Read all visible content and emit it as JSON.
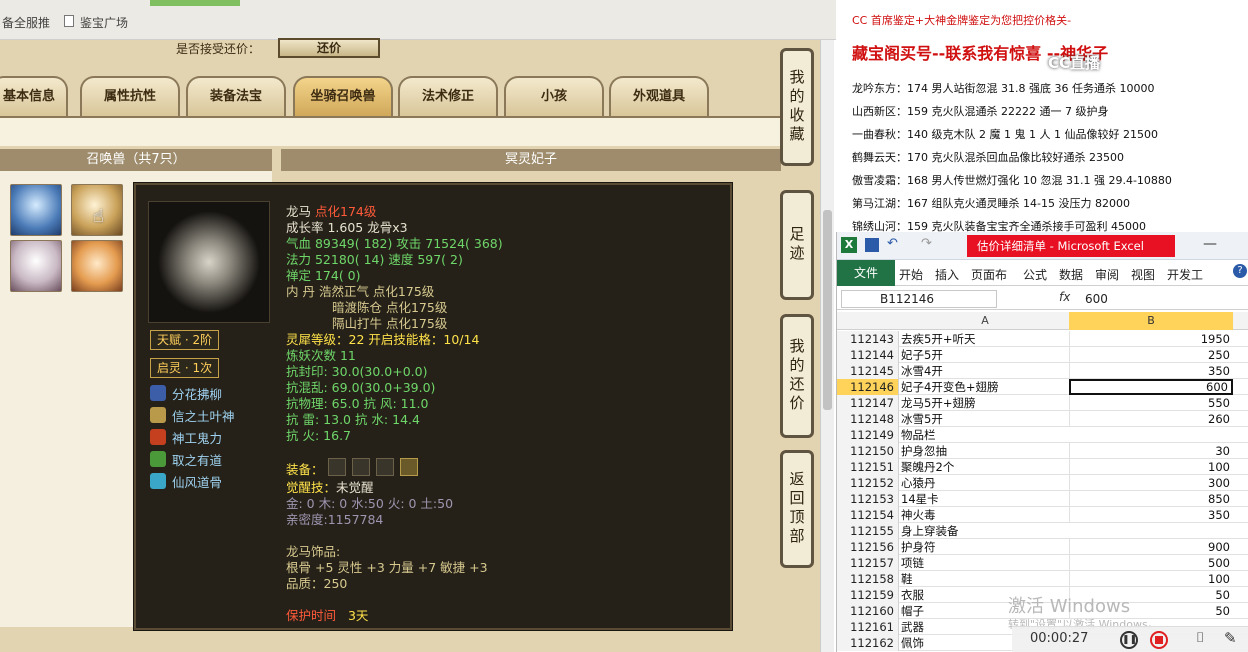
{
  "browser": {
    "bookmarks": [
      "备全服推",
      "鉴宝广场"
    ]
  },
  "game": {
    "header_text": "是否接受还价：",
    "header_btn": "还价",
    "tabs": [
      "基本信息",
      "属性抗性",
      "装备法宝",
      "坐骑召唤兽",
      "法术修正",
      "小孩",
      "外观道具"
    ],
    "active_tab": "坐骑召唤兽",
    "pets_panel_title": "召唤兽（共7只）",
    "right_panel_title": "冥灵妃子",
    "side_buttons": [
      "我的收藏",
      "足迹",
      "我的还价",
      "返回顶部"
    ]
  },
  "tooltip": {
    "name": "龙马",
    "name_suffix": "点化174级",
    "growth": "成长率 1.605 龙骨x3",
    "hp": "气血 89349( 182) 攻击 71524( 368)",
    "mp": "法力 52180( 14) 速度 597( 2)",
    "ding": "禅定 174( 0)",
    "neidan1": "内    丹  浩然正气 点化175级",
    "neidan2": "暗渡陈仓 点化175级",
    "neidan3": "隔山打牛 点化175级",
    "spirit_level": "灵犀等级：22 开启技能格：10/14",
    "refine": "炼妖次数 11",
    "res1": "抗封印: 30.0(30.0+0.0)",
    "res2": "抗混乱: 69.0(30.0+39.0)",
    "res3": "抗物理: 65.0 抗    风: 11.0",
    "res4": "抗    雷: 13.0 抗    水: 14.4",
    "res5": "抗    火: 16.7",
    "equip_label": "装备：",
    "awaken_label": "觉醒技：",
    "awaken_value": "未觉醒",
    "elements": "金: 0 木: 0 水:50 火: 0 土:50",
    "intimacy": "亲密度:1157784",
    "acc_title": "龙马饰品:",
    "acc_stats": "根骨 +5 灵性 +3 力量 +7 敏捷 +3",
    "acc_quality": "品质：250",
    "protect_label": "保护时间",
    "protect_value": "3天",
    "badges": [
      "天赋 · 2阶",
      "启灵 · 1次"
    ],
    "skills": [
      "分花拂柳",
      "信之土叶神",
      "神工鬼力",
      "取之有道",
      "仙风道骨"
    ]
  },
  "news": {
    "line0": "CC 首席鉴定+大神金牌鉴定为您把控价格关-",
    "headline": "藏宝阁买号--联系我有惊喜 --神华子",
    "items": [
      "龙吟东方：174 男人站街忽混 31.8 强底 36 任务通杀 10000",
      "山西新区：159 克火队混通杀 22222 通一 7 级护身",
      "一曲春秋：140 级克木队 2 魔 1 鬼 1 人 1 仙品像较好 21500",
      "鹤舞云天：170 克火队混杀回血品像比较好通杀 23500",
      "傲雪凌霜：168 男人传世燃灯强化 10 忽混 31.1 强 29.4-10880",
      "第马江湖：167 组队克火通灵睡杀 14-15 没压力 82000",
      "锦绣山河：159 克火队装备宝宝齐全通杀接手可盈利 45000"
    ]
  },
  "excel": {
    "title": "估价详细清单 - Microsoft Excel",
    "ribbon_tabs": [
      "文件",
      "开始",
      "插入",
      "页面布",
      "公式",
      "数据",
      "审阅",
      "视图",
      "开发工"
    ],
    "name_box": "B112146",
    "fx": "fx",
    "formula": "600",
    "col_a": "A",
    "col_b": "B",
    "rows": [
      {
        "n": "112143",
        "a": "去疾5开+听天",
        "b": "1950"
      },
      {
        "n": "112144",
        "a": "妃子5开",
        "b": "250"
      },
      {
        "n": "112145",
        "a": "冰雪4开",
        "b": "350"
      },
      {
        "n": "112146",
        "a": "妃子4开变色+翅膀",
        "b": "600"
      },
      {
        "n": "112147",
        "a": "龙马5开+翅膀",
        "b": "550"
      },
      {
        "n": "112148",
        "a": "冰雪5开",
        "b": "260"
      },
      {
        "n": "112149",
        "a": "物品栏",
        "b": ""
      },
      {
        "n": "112150",
        "a": "护身忽抽",
        "b": "30"
      },
      {
        "n": "112151",
        "a": "聚魄丹2个",
        "b": "100"
      },
      {
        "n": "112152",
        "a": "心猿丹",
        "b": "300"
      },
      {
        "n": "112153",
        "a": "14星卡",
        "b": "850"
      },
      {
        "n": "112154",
        "a": "神火毒",
        "b": "350"
      },
      {
        "n": "112155",
        "a": "身上穿装备",
        "b": ""
      },
      {
        "n": "112156",
        "a": "护身符",
        "b": "900"
      },
      {
        "n": "112157",
        "a": "项链",
        "b": "500"
      },
      {
        "n": "112158",
        "a": "鞋",
        "b": "100"
      },
      {
        "n": "112159",
        "a": "衣服",
        "b": "50"
      },
      {
        "n": "112160",
        "a": "帽子",
        "b": "50"
      },
      {
        "n": "112161",
        "a": "武器",
        "b": ""
      },
      {
        "n": "112162",
        "a": "佩饰",
        "b": ""
      }
    ],
    "selected_row": "112146"
  },
  "overlay": {
    "activate": "激活 Windows",
    "activate_sub": "转到\"设置\"以激活 Windows。",
    "timer": "00:00:27",
    "watermark": "CC直播"
  }
}
